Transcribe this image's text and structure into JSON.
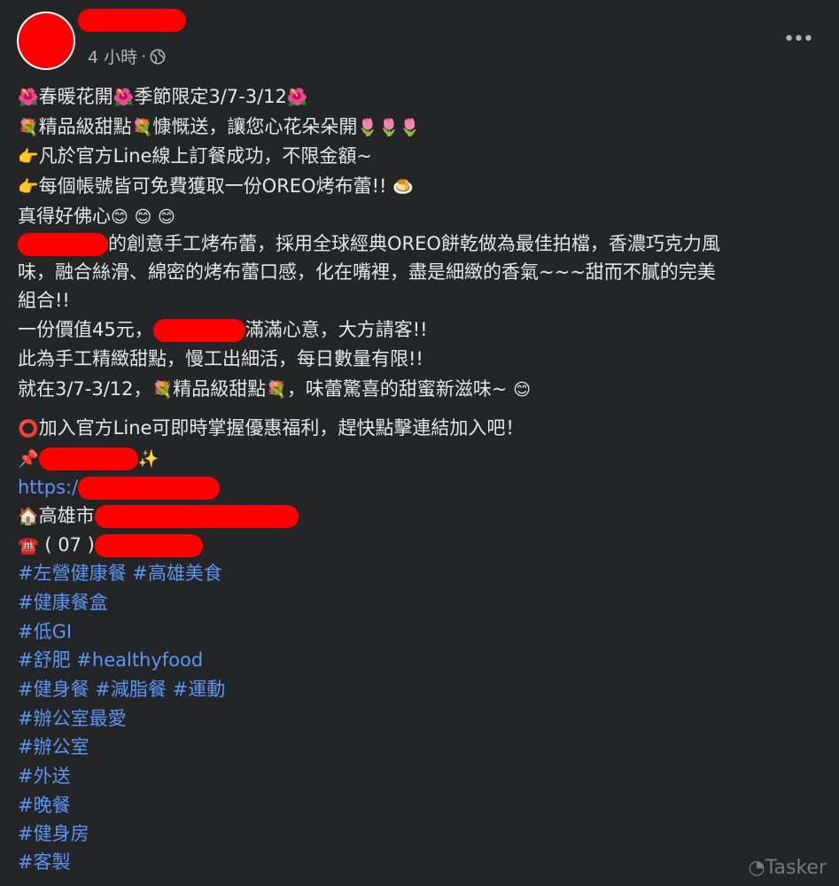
{
  "post": {
    "timestamp": "4 小時",
    "separator": "·",
    "more_label": "•••",
    "lines": {
      "l1a": "春暖花開",
      "l1b": "季節限定3/7-3/12",
      "l2a": "精品級甜點",
      "l2b": "慷慨送，讓您心花朵朵開",
      "l3": "凡於官方Line線上訂餐成功，不限金額~",
      "l4": "每個帳號皆可免費獲取一份OREO烤布蕾!!",
      "l5": "真得好佛心",
      "l6": "的創意手工烤布蕾，採用全球經典OREO餅乾做為最佳拍檔，香濃巧克力風",
      "l7": "味，融合絲滑、綿密的烤布蕾口感，化在嘴裡，盡是細緻的香氣~~~甜而不膩的完美",
      "l8": "組合!!",
      "l9a": "一份價值45元，",
      "l9b": "滿滿心意，大方請客!!",
      "l10": "此為手工精緻甜點，慢工出細活，每日數量有限!!",
      "l11a": "就在3/7-3/12，",
      "l11b": "精品級甜點",
      "l11c": "，味蕾驚喜的甜蜜新滋味~",
      "l12": "加入官方Line可即時掌握優惠福利，趕快點擊連結加入吧！",
      "l14": "https:/",
      "l15": "高雄市",
      "l16": "( 07 )"
    },
    "hashtags": [
      "#左營健康餐",
      "#高雄美食",
      "#健康餐盒",
      "#低GI",
      "#舒肥",
      "#healthyfood",
      "#健身餐",
      "#減脂餐",
      "#運動",
      "#辦公室最愛",
      "#辦公室",
      "#外送",
      "#晚餐",
      "#健身房",
      "#客製"
    ],
    "watermark": "Tasker"
  },
  "colors": {
    "background": "#242526",
    "text": "#e4e6eb",
    "secondary": "#b0b3b8",
    "link": "#5b95f6",
    "redaction": "#ff0000"
  },
  "icons": {
    "flower": "hibiscus-emoji",
    "bouquet": "bouquet-emoji",
    "tulip": "tulip-emoji",
    "pointing": "backhand-index-pointing-right-emoji",
    "pudding": "custard-emoji",
    "smile": "smiling-face-emoji",
    "circle": "hollow-red-circle-emoji",
    "pin": "pushpin-emoji",
    "sparkles": "sparkles-emoji",
    "house": "house-emoji",
    "phone": "telephone-emoji"
  }
}
